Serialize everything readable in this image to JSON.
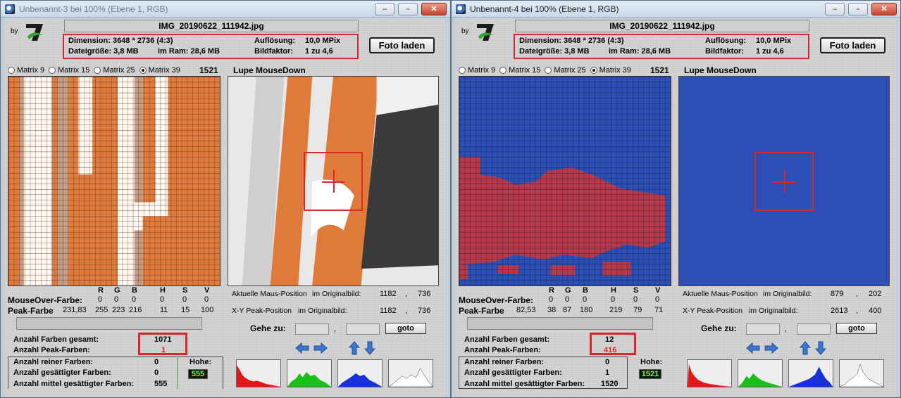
{
  "window_left": {
    "title": "Unbenannt-3 bei 100% (Ebene 1, RGB)",
    "by_label": "by",
    "filename": "IMG_20190622_111942.jpg",
    "info": {
      "dimension": "Dimension: 3648 * 2736 (4:3)",
      "aufloesung_label": "Auflösung:",
      "aufloesung_value": "10,0 MPix",
      "dateigroesse": "Dateigröße: 3,8 MB",
      "ram": "im Ram: 28,6 MB",
      "bildfaktor_label": "Bildfaktor:",
      "bildfaktor_value": "1 zu 4,6"
    },
    "foto_button": "Foto laden",
    "matrix_options": [
      "Matrix 9",
      "Matrix 15",
      "Matrix 25",
      "Matrix 39"
    ],
    "matrix_selected": "Matrix 39",
    "matrix_count": "1521",
    "lupe_title": "Lupe MouseDown",
    "rgb_headers": [
      "R",
      "G",
      "B",
      "H",
      "S",
      "V"
    ],
    "mouseover_label": "MouseOver-Farbe:",
    "mouseover_values": [
      "0",
      "0",
      "0",
      "0",
      "0",
      "0"
    ],
    "peak_label": "Peak-Farbe",
    "peak_lead": "231,83",
    "peak_values": [
      "255",
      "223",
      "216",
      "11",
      "15",
      "100"
    ],
    "maus_position_label": "Aktuelle Maus-Position",
    "original_label": "im Originalbild:",
    "maus_x": "1182",
    "maus_y": "736",
    "peak_position_label": "X-Y Peak-Position",
    "peak_x": "1182",
    "peak_y": "736",
    "gehe_zu": "Gehe zu:",
    "comma": ",",
    "goto_button": "goto",
    "farben_gesamt_label": "Anzahl Farben gesamt:",
    "farben_gesamt": "1071",
    "peak_farben_label": "Anzahl Peak-Farben:",
    "peak_farben": "1",
    "reiner_label": "Anzahl reiner Farben:",
    "reiner": "0",
    "gesaettigt_label": "Anzahl gesättigter Farben:",
    "gesaettigt": "0",
    "mittel_label": "Anzahl mittel gesättigter Farben:",
    "mittel": "555",
    "hoehe_label": "Hohe:",
    "hoehe": "555"
  },
  "window_right": {
    "title": "Unbenannt-4 bei 100% (Ebene 1, RGB)",
    "by_label": "by",
    "filename": "IMG_20190622_111942.jpg",
    "info": {
      "dimension": "Dimension: 3648 * 2736 (4:3)",
      "aufloesung_label": "Auflösung:",
      "aufloesung_value": "10,0 MPix",
      "dateigroesse": "Dateigröße: 3,8 MB",
      "ram": "im Ram: 28,6 MB",
      "bildfaktor_label": "Bildfaktor:",
      "bildfaktor_value": "1 zu 4,6"
    },
    "foto_button": "Foto laden",
    "matrix_options": [
      "Matrix 9",
      "Matrix 15",
      "Matrix 25",
      "Matrix 39"
    ],
    "matrix_selected": "Matrix 39",
    "matrix_count": "1521",
    "lupe_title": "Lupe MouseDown",
    "rgb_headers": [
      "R",
      "G",
      "B",
      "H",
      "S",
      "V"
    ],
    "mouseover_label": "MouseOver-Farbe:",
    "mouseover_values": [
      "0",
      "0",
      "0",
      "0",
      "0",
      "0"
    ],
    "peak_label": "Peak-Farbe",
    "peak_lead": "82,53",
    "peak_values": [
      "38",
      "87",
      "180",
      "219",
      "79",
      "71"
    ],
    "maus_position_label": "Aktuelle Maus-Position",
    "original_label": "im Originalbild:",
    "maus_x": "879",
    "maus_y": "202",
    "peak_position_label": "X-Y Peak-Position",
    "peak_x": "2613",
    "peak_y": "400",
    "gehe_zu": "Gehe zu:",
    "comma": ",",
    "goto_button": "goto",
    "farben_gesamt_label": "Anzahl Farben gesamt:",
    "farben_gesamt": "12",
    "peak_farben_label": "Anzahl Peak-Farben:",
    "peak_farben": "416",
    "reiner_label": "Anzahl reiner Farben:",
    "reiner": "0",
    "gesaettigt_label": "Anzahl gesättigter Farben:",
    "gesaettigt": "1",
    "mittel_label": "Anzahl mittel gesättigter Farben:",
    "mittel": "1520",
    "hoehe_label": "Hohe:",
    "hoehe": "1521"
  },
  "colors": {
    "highlight_red": "#d9262b",
    "orange": "#e07a3a",
    "blue": "#2d4fb5",
    "grid_red": "#b8394a"
  }
}
